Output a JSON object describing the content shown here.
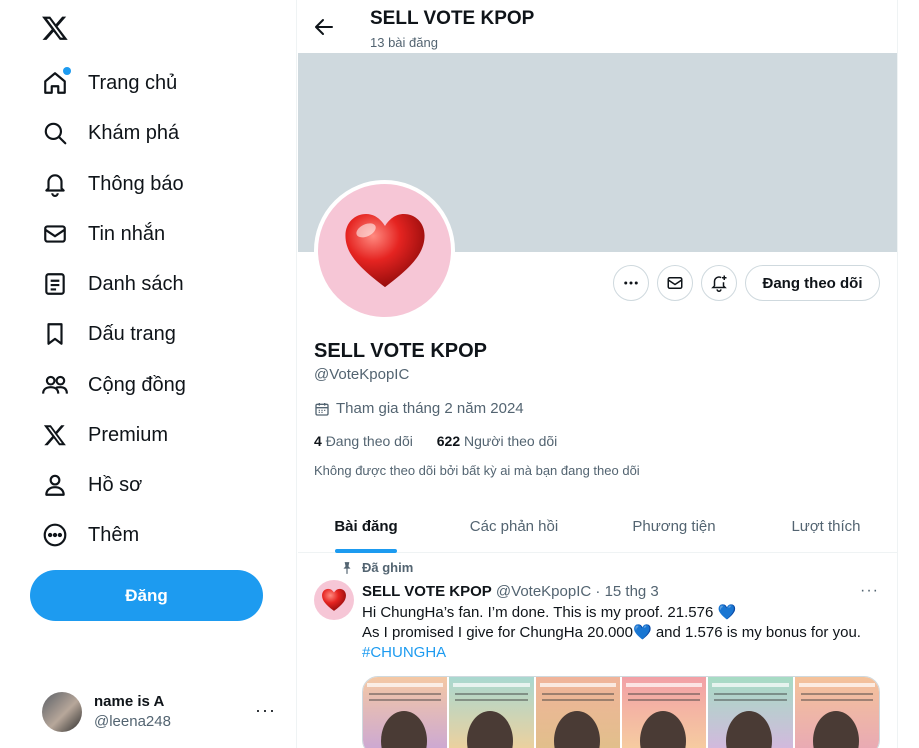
{
  "sidebar": {
    "logo_icon": "x-logo-icon",
    "items": [
      {
        "label": "Trang chủ",
        "icon": "home-icon",
        "has_dot": true
      },
      {
        "label": "Khám phá",
        "icon": "search-icon"
      },
      {
        "label": "Thông báo",
        "icon": "bell-icon"
      },
      {
        "label": "Tin nhắn",
        "icon": "mail-icon"
      },
      {
        "label": "Danh sách",
        "icon": "list-icon"
      },
      {
        "label": "Dấu trang",
        "icon": "bookmark-icon"
      },
      {
        "label": "Cộng đồng",
        "icon": "community-icon"
      },
      {
        "label": "Premium",
        "icon": "x-premium-icon"
      },
      {
        "label": "Hồ sơ",
        "icon": "profile-icon"
      },
      {
        "label": "Thêm",
        "icon": "more-circle-icon"
      }
    ],
    "post_button": "Đăng",
    "account": {
      "name": "name is A",
      "handle": "@leena248",
      "more": "···"
    }
  },
  "header": {
    "title": "SELL VOTE KPOP",
    "post_count": "13 bài đăng"
  },
  "profile": {
    "name": "SELL VOTE KPOP",
    "handle": "@VoteKpopIC",
    "joined": "Tham gia tháng 2 năm 2024",
    "following_count": "4",
    "following_label": "Đang theo dõi",
    "followers_count": "622",
    "followers_label": "Người theo dõi",
    "followed_by_note": "Không được theo dõi bởi bất kỳ ai mà bạn đang theo dõi",
    "follow_button": "Đang theo dõi",
    "banner_color": "#cfd9de",
    "avatar_bg": "#f6c6d6"
  },
  "tabs": [
    {
      "label": "Bài đăng",
      "active": true
    },
    {
      "label": "Các phản hồi"
    },
    {
      "label": "Phương tiện"
    },
    {
      "label": "Lượt thích"
    }
  ],
  "tweet": {
    "pinned_label": "Đã ghim",
    "author_name": "SELL VOTE KPOP",
    "author_handle": "@VoteKpopIC",
    "separator": "·",
    "date": "15 thg 3",
    "line1": "Hi ChungHa’s fan. I’m done. This is my proof. 21.576 💙",
    "line2": "As I promised I give for ChungHa 20.000💙 and 1.576 is my bonus for you.",
    "hashtag": "#CHUNGHA",
    "more": "···",
    "media_gradients": [
      [
        "#f4c8a4",
        "#c9a6d6"
      ],
      [
        "#a9d8d0",
        "#f2d09a"
      ],
      [
        "#f0b49a",
        "#e0c08a"
      ],
      [
        "#f2a0a6",
        "#f6d0a0"
      ],
      [
        "#a6dcc4",
        "#d6b6e0"
      ],
      [
        "#f4c29a",
        "#e8a8b6"
      ]
    ]
  },
  "colors": {
    "accent": "#1d9bf0",
    "text": "#0f1419",
    "muted": "#536471"
  }
}
